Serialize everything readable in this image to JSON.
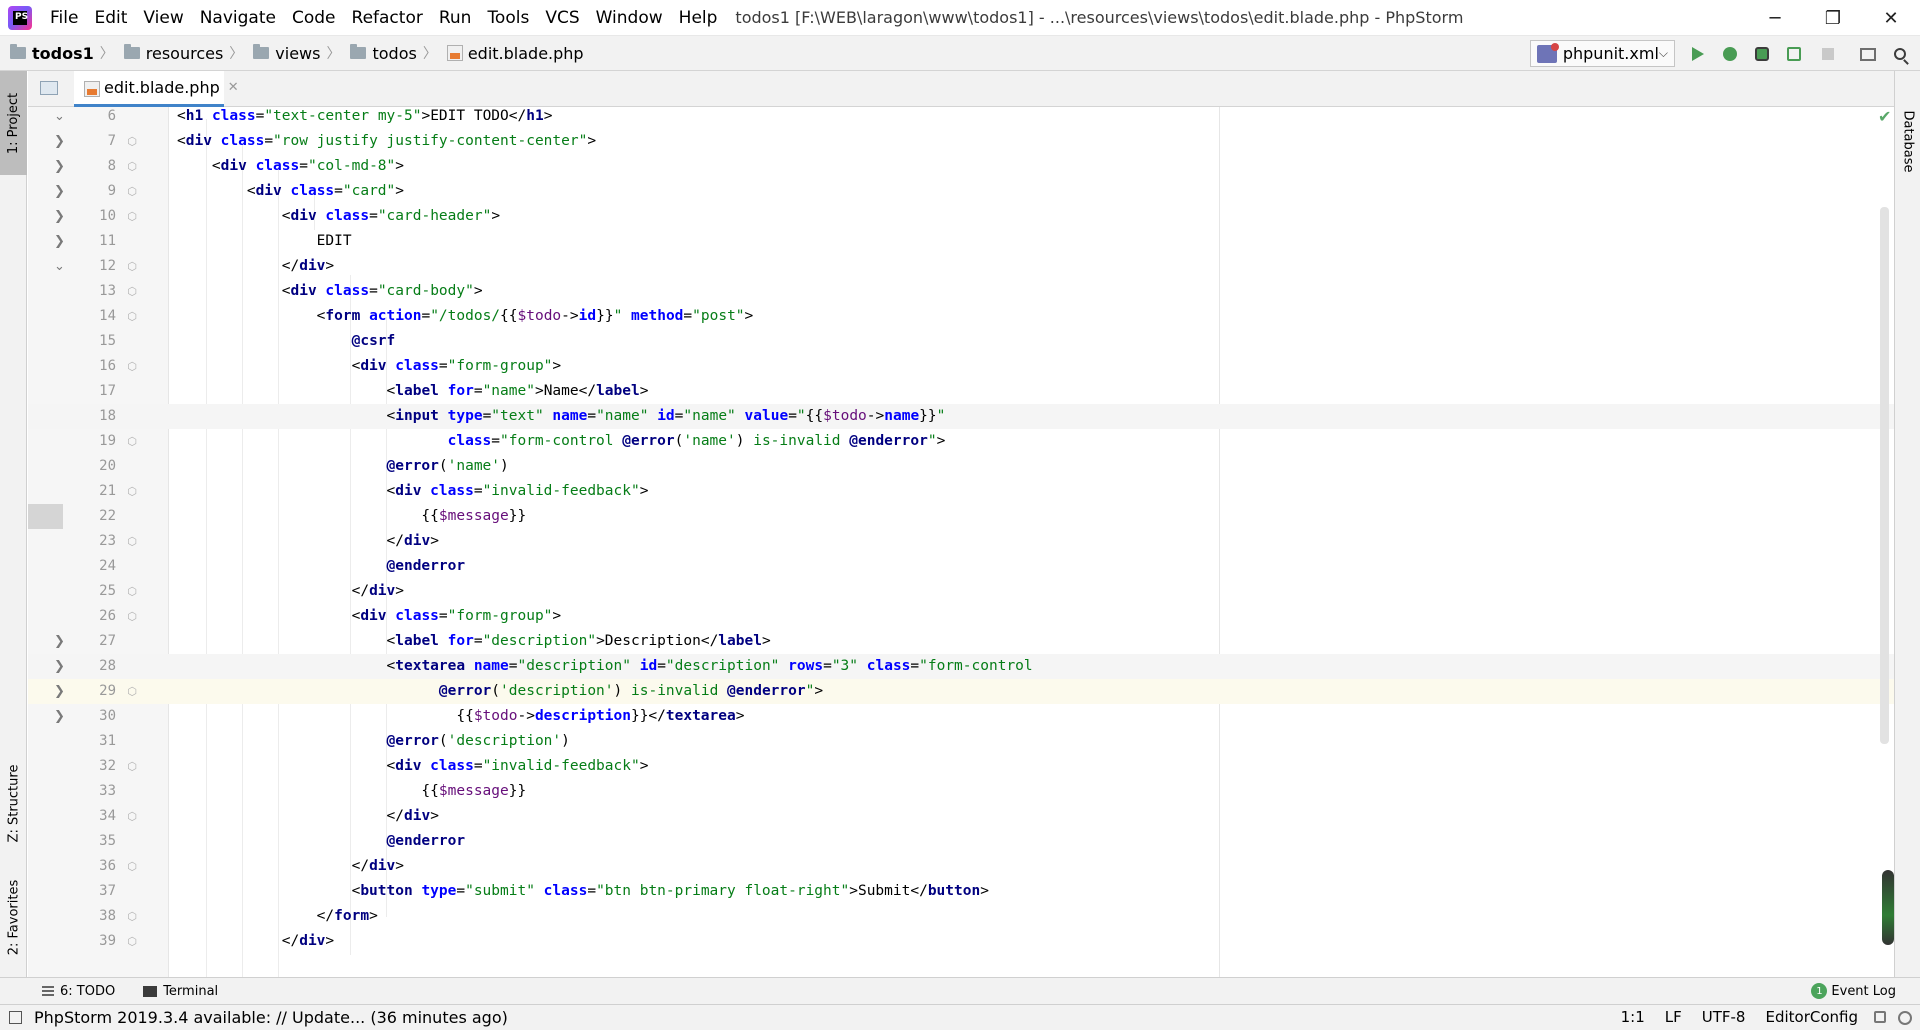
{
  "menu": {
    "items": [
      "File",
      "Edit",
      "View",
      "Navigate",
      "Code",
      "Refactor",
      "Run",
      "Tools",
      "VCS",
      "Window",
      "Help"
    ],
    "window_title": "todos1 [F:\\WEB\\laragon\\www\\todos1] - ...\\resources\\views\\todos\\edit.blade.php - PhpStorm",
    "logo_text": "PS"
  },
  "window_controls": {
    "minimize": "─",
    "restore": "❐",
    "close": "✕"
  },
  "breadcrumb": {
    "project": "todos1",
    "folders": [
      "resources",
      "views",
      "todos"
    ],
    "file": "edit.blade.php",
    "separator": "〉"
  },
  "run_config": {
    "label": "phpunit.xml",
    "chevron": "⌵"
  },
  "toolbar_icons": [
    "run-icon",
    "debug-icon",
    "coverage-icon",
    "profile-icon",
    "stop-icon",
    "frame-icon",
    "search-icon"
  ],
  "left_tools": {
    "project": "1: Project",
    "structure": "Z: Structure",
    "favorites": "2: Favorites"
  },
  "right_tools": {
    "database": "Database"
  },
  "editor_tab": {
    "label": "edit.blade.php",
    "close": "✕"
  },
  "colors": {
    "tag": "#000080",
    "attr": "#0000ff",
    "string": "#067d17",
    "directive": "#000080",
    "variable": "#660e7a",
    "accent": "#4083c9"
  },
  "editor": {
    "caret_line": 29,
    "lines": [
      {
        "n": "6",
        "fold": "",
        "marker": "⌄",
        "code": [
          [
            "p",
            "<"
          ],
          [
            "t",
            "h1 "
          ],
          [
            "a",
            "class"
          ],
          [
            "p",
            "="
          ],
          [
            "s",
            "\"text-center my-5\""
          ],
          [
            "p",
            ">EDIT TODO</"
          ],
          [
            "t",
            "h1"
          ],
          [
            "p",
            ">"
          ]
        ]
      },
      {
        "n": "7",
        "fold": "⬡",
        "marker": "❯",
        "code": [
          [
            "p",
            "<"
          ],
          [
            "t",
            "div "
          ],
          [
            "a",
            "class"
          ],
          [
            "p",
            "="
          ],
          [
            "s",
            "\"row justify justify-content-center\""
          ],
          [
            "p",
            ">"
          ]
        ]
      },
      {
        "n": "8",
        "fold": "⬡",
        "marker": "❯",
        "code": [
          [
            "p",
            "    <"
          ],
          [
            "t",
            "div "
          ],
          [
            "a",
            "class"
          ],
          [
            "p",
            "="
          ],
          [
            "s",
            "\"col-md-8\""
          ],
          [
            "p",
            ">"
          ]
        ]
      },
      {
        "n": "9",
        "fold": "⬡",
        "marker": "❯",
        "code": [
          [
            "p",
            "        <"
          ],
          [
            "t",
            "div "
          ],
          [
            "a",
            "class"
          ],
          [
            "p",
            "="
          ],
          [
            "s",
            "\"card\""
          ],
          [
            "p",
            ">"
          ]
        ]
      },
      {
        "n": "10",
        "fold": "⬡",
        "marker": "❯",
        "code": [
          [
            "p",
            "            <"
          ],
          [
            "t",
            "div "
          ],
          [
            "a",
            "class"
          ],
          [
            "p",
            "="
          ],
          [
            "s",
            "\"card-header\""
          ],
          [
            "p",
            ">"
          ]
        ]
      },
      {
        "n": "11",
        "fold": "",
        "marker": "❯",
        "code": [
          [
            "p",
            "                EDIT"
          ]
        ]
      },
      {
        "n": "12",
        "fold": "⬡",
        "marker": "⌄",
        "code": [
          [
            "p",
            "            </"
          ],
          [
            "t",
            "div"
          ],
          [
            "p",
            ">"
          ]
        ]
      },
      {
        "n": "13",
        "fold": "⬡",
        "marker": "",
        "code": [
          [
            "p",
            "            <"
          ],
          [
            "t",
            "div "
          ],
          [
            "a",
            "class"
          ],
          [
            "p",
            "="
          ],
          [
            "s",
            "\"card-body\""
          ],
          [
            "p",
            ">"
          ]
        ]
      },
      {
        "n": "14",
        "fold": "⬡",
        "marker": "",
        "code": [
          [
            "p",
            "                <"
          ],
          [
            "t",
            "form "
          ],
          [
            "a",
            "action"
          ],
          [
            "p",
            "="
          ],
          [
            "s",
            "\"/todos/"
          ],
          [
            "p",
            "{{"
          ],
          [
            "v",
            "$todo"
          ],
          [
            "p",
            "->"
          ],
          [
            "k",
            "id"
          ],
          [
            "p",
            "}}"
          ],
          [
            "s",
            "\""
          ],
          [
            "p",
            " "
          ],
          [
            "a",
            "method"
          ],
          [
            "p",
            "="
          ],
          [
            "s",
            "\"post\""
          ],
          [
            "p",
            ">"
          ]
        ]
      },
      {
        "n": "15",
        "fold": "",
        "marker": "",
        "code": [
          [
            "p",
            "                    "
          ],
          [
            "d",
            "@csrf"
          ]
        ]
      },
      {
        "n": "16",
        "fold": "⬡",
        "marker": "",
        "code": [
          [
            "p",
            "                    <"
          ],
          [
            "t",
            "div "
          ],
          [
            "a",
            "class"
          ],
          [
            "p",
            "="
          ],
          [
            "s",
            "\"form-group\""
          ],
          [
            "p",
            ">"
          ]
        ]
      },
      {
        "n": "17",
        "fold": "",
        "marker": "",
        "code": [
          [
            "p",
            "                        <"
          ],
          [
            "t",
            "label "
          ],
          [
            "a",
            "for"
          ],
          [
            "p",
            "="
          ],
          [
            "s",
            "\"name\""
          ],
          [
            "p",
            ">Name</"
          ],
          [
            "t",
            "label"
          ],
          [
            "p",
            ">"
          ]
        ]
      },
      {
        "n": "18",
        "fold": "",
        "marker": "",
        "code": [
          [
            "p",
            "                        <"
          ],
          [
            "t",
            "input "
          ],
          [
            "a",
            "type"
          ],
          [
            "p",
            "="
          ],
          [
            "s",
            "\"text\""
          ],
          [
            "p",
            " "
          ],
          [
            "a",
            "name"
          ],
          [
            "p",
            "="
          ],
          [
            "s",
            "\"name\""
          ],
          [
            "p",
            " "
          ],
          [
            "a",
            "id"
          ],
          [
            "p",
            "="
          ],
          [
            "s",
            "\"name\""
          ],
          [
            "p",
            " "
          ],
          [
            "a",
            "value"
          ],
          [
            "p",
            "="
          ],
          [
            "s",
            "\""
          ],
          [
            "p",
            "{{"
          ],
          [
            "v",
            "$todo"
          ],
          [
            "p",
            "->"
          ],
          [
            "k",
            "name"
          ],
          [
            "p",
            "}}"
          ],
          [
            "s",
            "\""
          ]
        ]
      },
      {
        "n": "19",
        "fold": "⬡",
        "marker": "",
        "code": [
          [
            "p",
            "                               "
          ],
          [
            "a",
            "class"
          ],
          [
            "p",
            "="
          ],
          [
            "s",
            "\"form-control "
          ],
          [
            "d",
            "@error"
          ],
          [
            "p",
            "("
          ],
          [
            "s",
            "'name'"
          ],
          [
            "p",
            ") "
          ],
          [
            "s",
            "is-invalid "
          ],
          [
            "d",
            "@enderror"
          ],
          [
            "s",
            "\""
          ],
          [
            "p",
            ">"
          ]
        ]
      },
      {
        "n": "20",
        "fold": "",
        "marker": "",
        "code": [
          [
            "p",
            "                        "
          ],
          [
            "d",
            "@error"
          ],
          [
            "p",
            "("
          ],
          [
            "s",
            "'name'"
          ],
          [
            "p",
            ")"
          ]
        ]
      },
      {
        "n": "21",
        "fold": "⬡",
        "marker": "",
        "code": [
          [
            "p",
            "                        <"
          ],
          [
            "t",
            "div "
          ],
          [
            "a",
            "class"
          ],
          [
            "p",
            "="
          ],
          [
            "s",
            "\"invalid-feedback\""
          ],
          [
            "p",
            ">"
          ]
        ]
      },
      {
        "n": "22",
        "fold": "",
        "marker": "",
        "code": [
          [
            "p",
            "                            {{"
          ],
          [
            "v",
            "$message"
          ],
          [
            "p",
            "}}"
          ]
        ]
      },
      {
        "n": "23",
        "fold": "⬡",
        "marker": "",
        "code": [
          [
            "p",
            "                        </"
          ],
          [
            "t",
            "div"
          ],
          [
            "p",
            ">"
          ]
        ]
      },
      {
        "n": "24",
        "fold": "",
        "marker": "",
        "code": [
          [
            "p",
            "                        "
          ],
          [
            "d",
            "@enderror"
          ]
        ]
      },
      {
        "n": "25",
        "fold": "⬡",
        "marker": "",
        "code": [
          [
            "p",
            "                    </"
          ],
          [
            "t",
            "div"
          ],
          [
            "p",
            ">"
          ]
        ]
      },
      {
        "n": "26",
        "fold": "⬡",
        "marker": "",
        "code": [
          [
            "p",
            "                    <"
          ],
          [
            "t",
            "div "
          ],
          [
            "a",
            "class"
          ],
          [
            "p",
            "="
          ],
          [
            "s",
            "\"form-group\""
          ],
          [
            "p",
            ">"
          ]
        ]
      },
      {
        "n": "27",
        "fold": "",
        "marker": "❯",
        "code": [
          [
            "p",
            "                        <"
          ],
          [
            "t",
            "label "
          ],
          [
            "a",
            "for"
          ],
          [
            "p",
            "="
          ],
          [
            "s",
            "\"description\""
          ],
          [
            "p",
            ">Description</"
          ],
          [
            "t",
            "label"
          ],
          [
            "p",
            ">"
          ]
        ]
      },
      {
        "n": "28",
        "fold": "",
        "marker": "❯",
        "code": [
          [
            "p",
            "                        <"
          ],
          [
            "t",
            "textarea "
          ],
          [
            "a",
            "name"
          ],
          [
            "p",
            "="
          ],
          [
            "s",
            "\"description\""
          ],
          [
            "p",
            " "
          ],
          [
            "a",
            "id"
          ],
          [
            "p",
            "="
          ],
          [
            "s",
            "\"description\""
          ],
          [
            "p",
            " "
          ],
          [
            "a",
            "rows"
          ],
          [
            "p",
            "="
          ],
          [
            "s",
            "\"3\""
          ],
          [
            "p",
            " "
          ],
          [
            "a",
            "class"
          ],
          [
            "p",
            "="
          ],
          [
            "s",
            "\"form-control"
          ]
        ]
      },
      {
        "n": "29",
        "fold": "⬡",
        "marker": "❯",
        "code": [
          [
            "p",
            "                              "
          ],
          [
            "d",
            "@error"
          ],
          [
            "p",
            "("
          ],
          [
            "s",
            "'description'"
          ],
          [
            "p",
            ") "
          ],
          [
            "s",
            "is-invalid "
          ],
          [
            "d",
            "@enderror"
          ],
          [
            "s",
            "\""
          ],
          [
            "p",
            ">"
          ]
        ]
      },
      {
        "n": "30",
        "fold": "",
        "marker": "❯",
        "code": [
          [
            "p",
            "                                {{"
          ],
          [
            "v",
            "$todo"
          ],
          [
            "p",
            "->"
          ],
          [
            "k",
            "description"
          ],
          [
            "p",
            "}}</"
          ],
          [
            "t",
            "textarea"
          ],
          [
            "p",
            ">"
          ]
        ]
      },
      {
        "n": "31",
        "fold": "",
        "marker": "",
        "code": [
          [
            "p",
            "                        "
          ],
          [
            "d",
            "@error"
          ],
          [
            "p",
            "("
          ],
          [
            "s",
            "'description'"
          ],
          [
            "p",
            ")"
          ]
        ]
      },
      {
        "n": "32",
        "fold": "⬡",
        "marker": "",
        "code": [
          [
            "p",
            "                        <"
          ],
          [
            "t",
            "div "
          ],
          [
            "a",
            "class"
          ],
          [
            "p",
            "="
          ],
          [
            "s",
            "\"invalid-feedback\""
          ],
          [
            "p",
            ">"
          ]
        ]
      },
      {
        "n": "33",
        "fold": "",
        "marker": "",
        "code": [
          [
            "p",
            "                            {{"
          ],
          [
            "v",
            "$message"
          ],
          [
            "p",
            "}}"
          ]
        ]
      },
      {
        "n": "34",
        "fold": "⬡",
        "marker": "",
        "code": [
          [
            "p",
            "                        </"
          ],
          [
            "t",
            "div"
          ],
          [
            "p",
            ">"
          ]
        ]
      },
      {
        "n": "35",
        "fold": "",
        "marker": "",
        "code": [
          [
            "p",
            "                        "
          ],
          [
            "d",
            "@enderror"
          ]
        ]
      },
      {
        "n": "36",
        "fold": "⬡",
        "marker": "",
        "code": [
          [
            "p",
            "                    </"
          ],
          [
            "t",
            "div"
          ],
          [
            "p",
            ">"
          ]
        ]
      },
      {
        "n": "37",
        "fold": "",
        "marker": "",
        "code": [
          [
            "p",
            "                    <"
          ],
          [
            "t",
            "button "
          ],
          [
            "a",
            "type"
          ],
          [
            "p",
            "="
          ],
          [
            "s",
            "\"submit\""
          ],
          [
            "p",
            " "
          ],
          [
            "a",
            "class"
          ],
          [
            "p",
            "="
          ],
          [
            "s",
            "\"btn btn-primary float-right\""
          ],
          [
            "p",
            ">Submit</"
          ],
          [
            "t",
            "button"
          ],
          [
            "p",
            ">"
          ]
        ]
      },
      {
        "n": "38",
        "fold": "⬡",
        "marker": "",
        "code": [
          [
            "p",
            "                </"
          ],
          [
            "t",
            "form"
          ],
          [
            "p",
            ">"
          ]
        ]
      },
      {
        "n": "39",
        "fold": "⬡",
        "marker": "",
        "code": [
          [
            "p",
            "            </"
          ],
          [
            "t",
            "div"
          ],
          [
            "p",
            ">"
          ]
        ]
      }
    ]
  },
  "bottom_tools": {
    "todo": "6: TODO",
    "terminal": "Terminal",
    "event_log": "Event Log",
    "event_count": "1"
  },
  "status": {
    "message": "PhpStorm 2019.3.4 available: // Update... (36 minutes ago)",
    "position": "1:1",
    "line_sep": "LF",
    "encoding": "UTF-8",
    "editorconfig": "EditorConfig"
  }
}
